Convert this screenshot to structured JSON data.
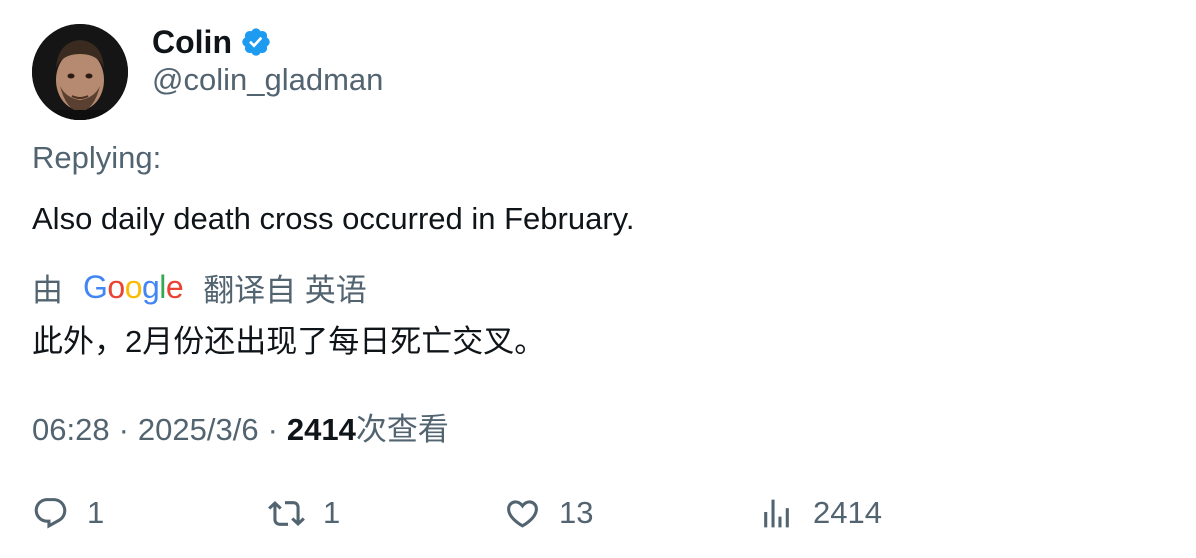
{
  "author": {
    "display_name": "Colin",
    "handle": "@colin_gladman",
    "verified_color": "#1d9bf0",
    "avatar_icon": "profile-photo"
  },
  "tweet": {
    "replying_label": "Replying:",
    "text": "Also daily death cross occurred in February.",
    "translation": {
      "prefix": "由",
      "provider": "Google",
      "suffix": "翻译自 英语",
      "text": "此外，2月份还出现了每日死亡交叉。"
    },
    "meta": {
      "time": "06:28",
      "separator": "·",
      "date": "2025/3/6",
      "views_count": "2414",
      "views_label": "次查看"
    }
  },
  "actions": {
    "reply_count": "1",
    "retweet_count": "1",
    "like_count": "13",
    "views_count": "2414"
  },
  "colors": {
    "text_primary": "#0f1419",
    "text_secondary": "#536471",
    "google_blue": "#4285F4",
    "google_red": "#EA4335",
    "google_yellow": "#FBBC05",
    "google_green": "#34A853"
  }
}
